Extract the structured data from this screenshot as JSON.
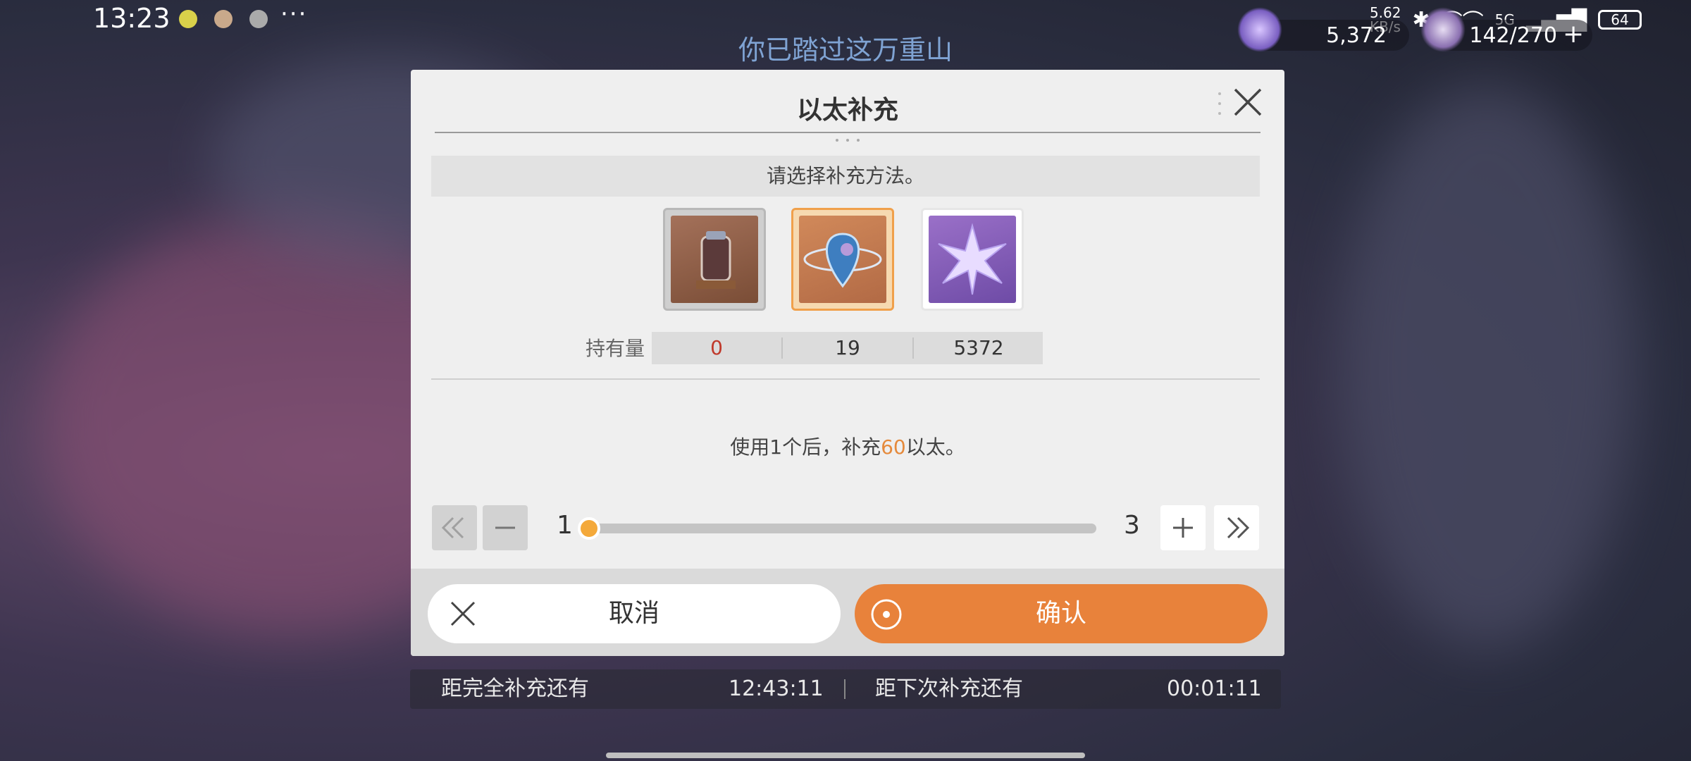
{
  "status_bar": {
    "time": "13:23",
    "more": "···",
    "net_speed": "5.62\nKB/s",
    "signal": "5G",
    "battery": "64"
  },
  "top": {
    "subtitle": "你已踏过这万重山",
    "stellar_jade": "5,372",
    "trailblaze_power": "142/270"
  },
  "dialog": {
    "title": "以太补充",
    "prompt": "请选择补充方法。",
    "items": [
      {
        "name": "fuel-jar",
        "count": "0",
        "count_color": "#c0392b"
      },
      {
        "name": "reserved-power",
        "count": "19",
        "count_color": "#333333"
      },
      {
        "name": "stellar-jade",
        "count": "5372",
        "count_color": "#333333"
      }
    ],
    "hold_label": "持有量",
    "effect_prefix": "使用1个后，补充",
    "effect_amount": "60",
    "effect_suffix": "以太。",
    "slider": {
      "min": "1",
      "max": "3",
      "value_fraction": 0
    },
    "cancel_label": "取消",
    "confirm_label": "确认"
  },
  "timers": {
    "full_label": "距完全补充还有",
    "full_value": "12:43:11",
    "next_label": "距下次补充还有",
    "next_value": "00:01:11"
  },
  "colors": {
    "accent": "#e8823b",
    "highlight": "#e58a3c",
    "selected_border": "#f0a04b"
  }
}
